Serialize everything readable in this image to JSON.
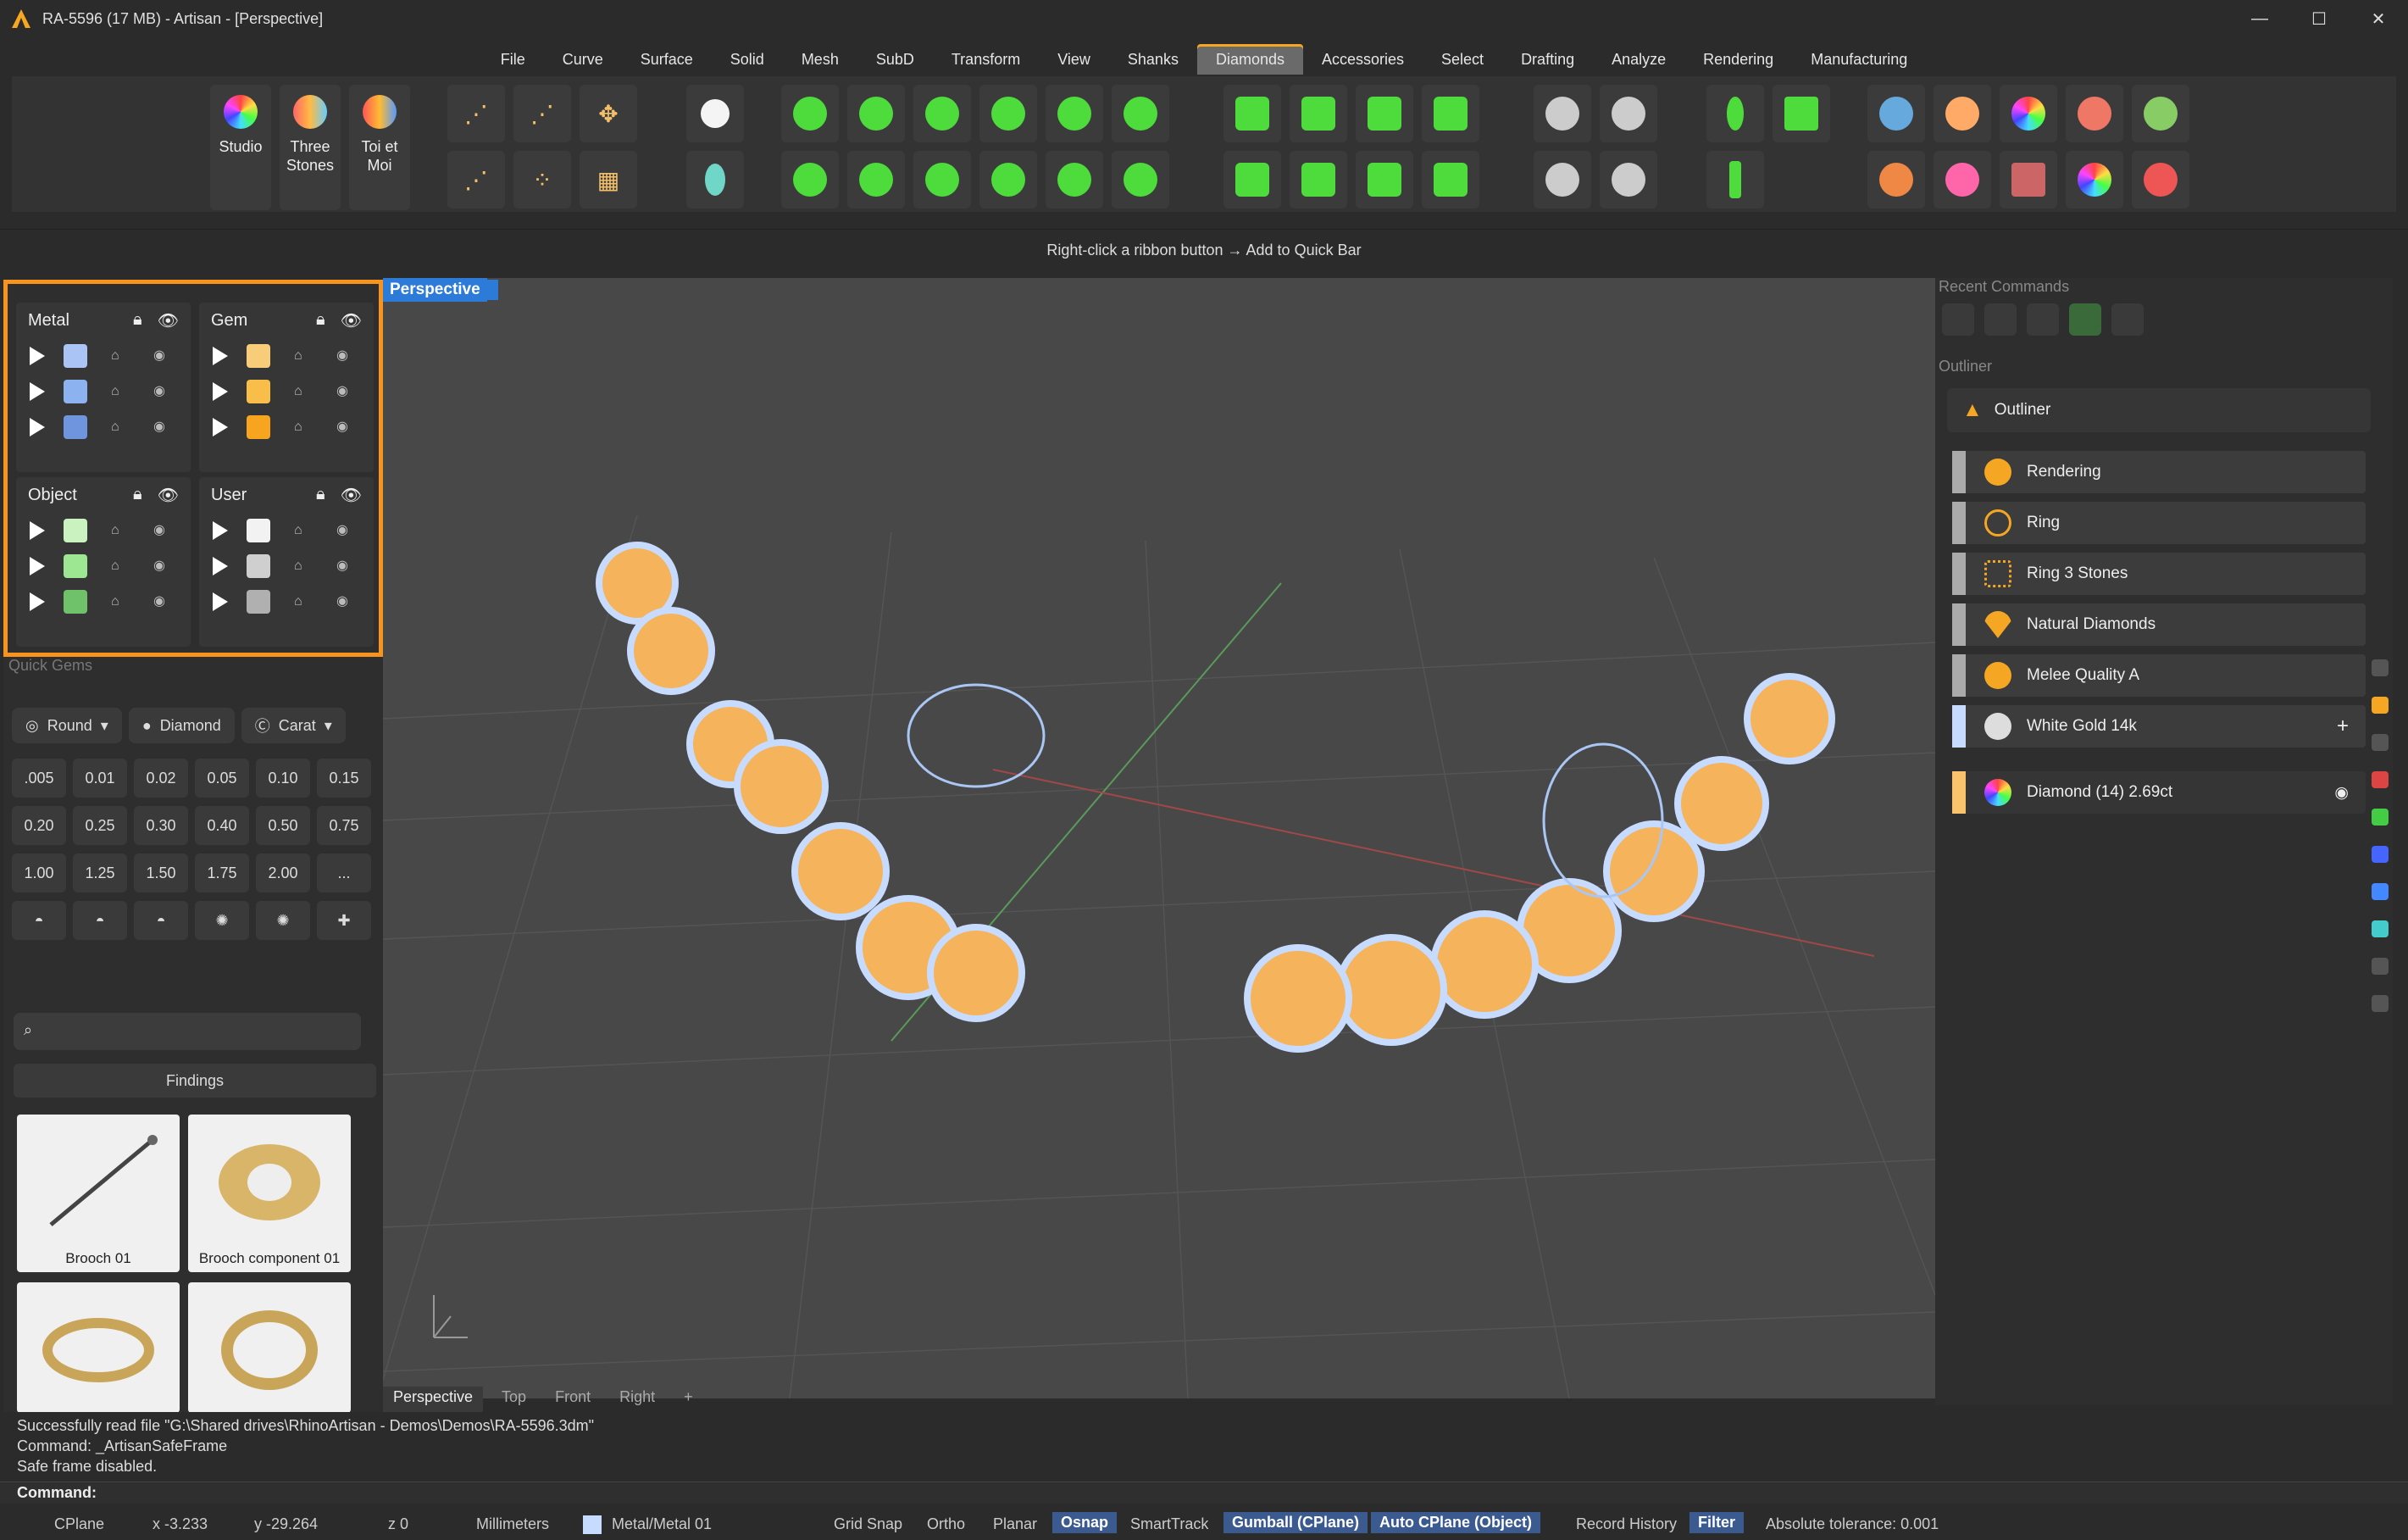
{
  "window": {
    "title": "RA-5596 (17 MB) - Artisan - [Perspective]",
    "minimize": "—",
    "maximize": "☐",
    "close": "✕"
  },
  "menu": [
    "File",
    "Curve",
    "Surface",
    "Solid",
    "Mesh",
    "SubD",
    "Transform",
    "View",
    "Shanks",
    "Diamonds",
    "Accessories",
    "Select",
    "Drafting",
    "Analyze",
    "Rendering",
    "Manufacturing"
  ],
  "menu_active": "Diamonds",
  "ribbon": {
    "studio": "Studio",
    "three_stones": "Three Stones",
    "toi_et_moi": "Toi et Moi"
  },
  "quickbar_hint": "Right-click a ribbon button → Add to Quick Bar",
  "layers": {
    "metal": {
      "title": "Metal",
      "colors": [
        "#a9c4f5",
        "#8db2f0",
        "#6f95de"
      ]
    },
    "gem": {
      "title": "Gem",
      "colors": [
        "#f8cd7a",
        "#f9be4a",
        "#f7a51e"
      ]
    },
    "object": {
      "title": "Object",
      "colors": [
        "#c9f2c0",
        "#9de793",
        "#6fc16a"
      ]
    },
    "user": {
      "title": "User",
      "colors": [
        "#f2f2f2",
        "#cfcfcf",
        "#b0b0b0"
      ]
    }
  },
  "quick_gems": {
    "label": "Quick Gems",
    "shape": "Round",
    "type": "Diamond",
    "unit": "Carat",
    "sizes": [
      ".005",
      "0.01",
      "0.02",
      "0.05",
      "0.10",
      "0.15",
      "0.20",
      "0.25",
      "0.30",
      "0.40",
      "0.50",
      "0.75",
      "1.00",
      "1.25",
      "1.50",
      "1.75",
      "2.00",
      "..."
    ]
  },
  "library": {
    "category": "Findings",
    "items": [
      {
        "name": "Brooch 01"
      },
      {
        "name": "Brooch component 01"
      },
      {
        "name": ""
      },
      {
        "name": ""
      }
    ]
  },
  "viewport": {
    "name": "Perspective",
    "tabs": [
      "Perspective",
      "Top",
      "Front",
      "Right",
      "+"
    ],
    "active_tab": "Perspective"
  },
  "recent_commands_label": "Recent Commands",
  "outliner": {
    "section_label": "Outliner",
    "header": "Outliner",
    "rows": [
      {
        "label": "Rendering",
        "icon": "palette-icon",
        "color": "#f5a623"
      },
      {
        "label": "Ring",
        "icon": "ring-icon",
        "color": "#f5a623"
      },
      {
        "label": "Ring 3 Stones",
        "icon": "three-stones-icon",
        "color": "#f5a623"
      },
      {
        "label": "Natural Diamonds",
        "icon": "diamond-icon",
        "color": "#f5a623"
      },
      {
        "label": "Melee Quality A",
        "icon": "quality-icon",
        "color": "#f5a623"
      },
      {
        "label": "White Gold 14k",
        "icon": "metal-icon",
        "color": "#dddddd"
      }
    ],
    "selected": {
      "label": "Diamond (14) 2.69ct",
      "color": "#f8c36b"
    }
  },
  "command_history": [
    "Successfully read file \"G:\\Shared drives\\RhinoArtisan - Demos\\Demos\\RA-5596.3dm\"",
    "Command: _ArtisanSafeFrame",
    "Safe frame disabled."
  ],
  "command_prompt": "Command:",
  "status": {
    "cplane": "CPlane",
    "x": "x -3.233",
    "y": "y -29.264",
    "z": "z 0",
    "units": "Millimeters",
    "layer": "Metal/Metal 01",
    "grid_snap": "Grid Snap",
    "ortho": "Ortho",
    "planar": "Planar",
    "osnap": "Osnap",
    "smarttrack": "SmartTrack",
    "gumball": "Gumball (CPlane)",
    "auto_cplane": "Auto CPlane (Object)",
    "record_history": "Record History",
    "filter": "Filter",
    "tolerance": "Absolute tolerance: 0.001"
  }
}
